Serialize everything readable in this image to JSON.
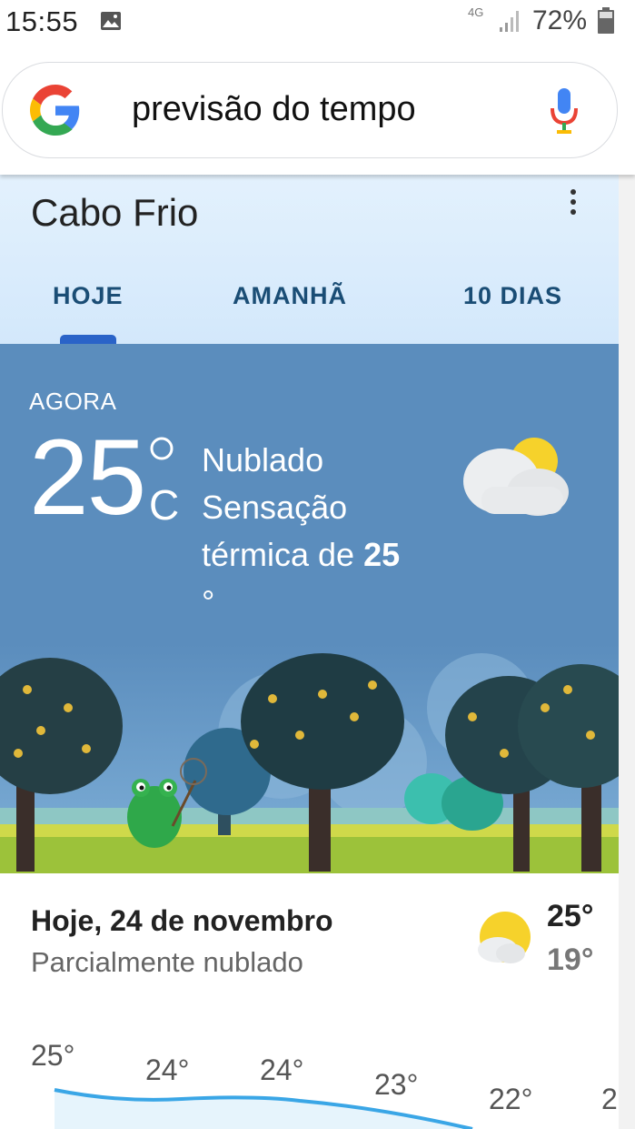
{
  "status_bar": {
    "time": "15:55",
    "network": "4G",
    "battery": "72%",
    "icons": [
      "image-icon",
      "signal-icon",
      "battery-icon"
    ]
  },
  "search": {
    "query": "previsão do tempo",
    "icons": [
      "google-logo-icon",
      "microphone-icon"
    ]
  },
  "weather": {
    "city": "Cabo Frio",
    "tabs": [
      "HOJE",
      "AMANHÃ",
      "10 DIAS"
    ],
    "selected_tab": "HOJE",
    "now": {
      "label": "AGORA",
      "temperature": "25",
      "unit": "C",
      "condition": "Nublado",
      "feels_like_prefix": "Sensação térmica de",
      "feels_like_value": "25",
      "feels_like_unit": "°",
      "icon": "partly-cloudy-icon"
    },
    "today": {
      "date": "Hoje, 24 de novembro",
      "condition": "Parcialmente nublado",
      "high": "25°",
      "low": "19°",
      "icon": "partly-cloudy-icon"
    },
    "hourly_temps": [
      "25°",
      "24°",
      "24°",
      "23°",
      "22°",
      "2"
    ]
  },
  "colors": {
    "panel_bg": "#5b8dbd",
    "header_bg": "#e3f1fd",
    "tab_text": "#1a4d75",
    "tab_indicator": "#2a63c8",
    "hourly_line": "#3aa6e6"
  }
}
